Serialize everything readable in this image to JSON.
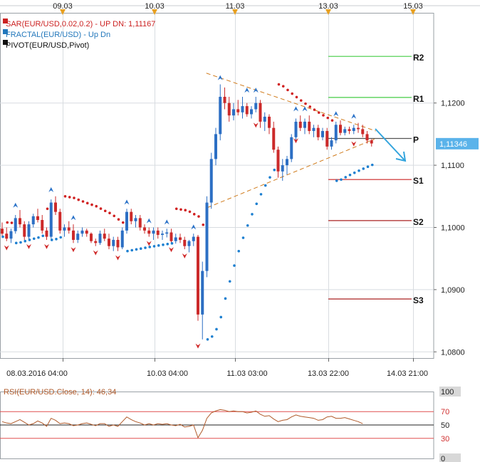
{
  "chart_data": [
    {
      "type": "candlestick",
      "symbol": "EUR/USD",
      "legend": [
        {
          "text": "SAR(EUR/USD,0.02,0.2) -  UP  DN: 1,11167",
          "color": "#cc2222"
        },
        {
          "text": "FRACTAL(EUR/USD) -  Up  Dn",
          "color": "#2277bb"
        },
        {
          "text": "PIVOT(EUR/USD,Pivot)",
          "color": "#111111"
        }
      ],
      "ylim": [
        1.079,
        1.1345
      ],
      "yticks": [
        {
          "value": 1.08,
          "label": "1,0800"
        },
        {
          "value": 1.09,
          "label": "1,0900"
        },
        {
          "value": 1.1,
          "label": "1,1000"
        },
        {
          "value": 1.11,
          "label": "1,1100"
        },
        {
          "value": 1.12,
          "label": "1,1200"
        }
      ],
      "top_dates": [
        "09.03",
        "10.03",
        "11.03",
        "13.03",
        "15.03"
      ],
      "bottom_dates": [
        "08.03.2016 04:00",
        "10.03 04:00",
        "11.03 03:00",
        "13.03 22:00",
        "14.03 21:00"
      ],
      "last_price": {
        "value": 1.11346,
        "label": "1,11346"
      },
      "pivot_levels": [
        {
          "name": "R2",
          "value": 1.1275,
          "color": "#44cc44"
        },
        {
          "name": "R1",
          "value": 1.1209,
          "color": "#44cc44"
        },
        {
          "name": "P",
          "value": 1.1143,
          "color": "#555555"
        },
        {
          "name": "S1",
          "value": 1.1077,
          "color": "#cc2222"
        },
        {
          "name": "S2",
          "value": 1.1011,
          "color": "#aa2222"
        },
        {
          "name": "S3",
          "value": 1.0885,
          "color": "#aa2222"
        }
      ],
      "candles": [
        [
          1.0998,
          1.1008,
          1.0985,
          1.099
        ],
        [
          1.099,
          1.1,
          1.0978,
          1.0982
        ],
        [
          1.0982,
          1.0998,
          1.0975,
          1.0994
        ],
        [
          1.0994,
          1.102,
          1.099,
          1.1015
        ],
        [
          1.1015,
          1.1028,
          1.1,
          1.1005
        ],
        [
          1.1005,
          1.101,
          1.098,
          1.0985
        ],
        [
          1.0985,
          1.101,
          1.098,
          1.1005
        ],
        [
          1.1005,
          1.1022,
          1.1,
          1.1018
        ],
        [
          1.1018,
          1.103,
          1.1008,
          1.1012
        ],
        [
          1.1012,
          1.102,
          1.099,
          1.0995
        ],
        [
          1.0995,
          1.1,
          1.098,
          1.0985
        ],
        [
          1.0985,
          1.1045,
          1.0982,
          1.104
        ],
        [
          1.104,
          1.105,
          1.102,
          1.1025
        ],
        [
          1.1025,
          1.103,
          1.099,
          1.0995
        ],
        [
          1.0995,
          1.1005,
          1.0985,
          1.1
        ],
        [
          1.1,
          1.101,
          1.099,
          1.0995
        ],
        [
          1.0995,
          1.1005,
          1.0975,
          1.098
        ],
        [
          1.098,
          1.0995,
          1.0975,
          1.099
        ],
        [
          1.099,
          1.1,
          1.0985,
          1.0995
        ],
        [
          1.0995,
          1.0998,
          1.0985,
          1.099
        ],
        [
          1.099,
          1.0992,
          1.0975,
          1.0978
        ],
        [
          1.0978,
          1.0982,
          1.097,
          1.0975
        ],
        [
          1.0975,
          1.0995,
          1.0972,
          1.099
        ],
        [
          1.099,
          1.0998,
          1.0978,
          1.0982
        ],
        [
          1.0982,
          1.099,
          1.0965,
          1.097
        ],
        [
          1.097,
          1.0985,
          1.0962,
          1.098
        ],
        [
          1.098,
          1.0985,
          1.0962,
          1.0968
        ],
        [
          1.0968,
          1.1,
          1.0965,
          1.0995
        ],
        [
          1.0995,
          1.103,
          1.099,
          1.1025
        ],
        [
          1.1025,
          1.103,
          1.1005,
          1.101
        ],
        [
          1.101,
          1.102,
          1.1,
          1.1015
        ],
        [
          1.1015,
          1.102,
          1.0995,
          1.1
        ],
        [
          1.1,
          1.1005,
          1.099,
          1.0995
        ],
        [
          1.0995,
          1.1,
          1.0985,
          1.099
        ],
        [
          1.099,
          1.1,
          1.098,
          1.0995
        ],
        [
          1.0995,
          1.1,
          1.0982,
          1.0988
        ],
        [
          1.0988,
          1.0995,
          1.098,
          1.099
        ],
        [
          1.099,
          1.0998,
          1.0984,
          1.0992
        ],
        [
          1.0992,
          1.0998,
          1.0975,
          1.0978
        ],
        [
          1.0978,
          1.099,
          1.0974,
          1.0984
        ],
        [
          1.0984,
          1.099,
          1.0975,
          1.098
        ],
        [
          1.098,
          1.0985,
          1.0965,
          1.097
        ],
        [
          1.097,
          1.098,
          1.096,
          1.0978
        ],
        [
          1.0978,
          1.099,
          1.097,
          1.0985
        ],
        [
          1.0985,
          1.0988,
          1.085,
          1.086
        ],
        [
          1.086,
          1.0945,
          1.082,
          1.093
        ],
        [
          1.093,
          1.105,
          1.092,
          1.104
        ],
        [
          1.104,
          1.112,
          1.103,
          1.111
        ],
        [
          1.111,
          1.116,
          1.11,
          1.115
        ],
        [
          1.115,
          1.123,
          1.114,
          1.121
        ],
        [
          1.121,
          1.1225,
          1.119,
          1.12
        ],
        [
          1.12,
          1.121,
          1.117,
          1.118
        ],
        [
          1.118,
          1.12,
          1.1172,
          1.119
        ],
        [
          1.119,
          1.1205,
          1.118,
          1.1185
        ],
        [
          1.1185,
          1.121,
          1.1175,
          1.1195
        ],
        [
          1.1195,
          1.12,
          1.1178,
          1.1182
        ],
        [
          1.1182,
          1.1195,
          1.1175,
          1.119
        ],
        [
          1.119,
          1.121,
          1.1185,
          1.12
        ],
        [
          1.12,
          1.1205,
          1.116,
          1.117
        ],
        [
          1.117,
          1.1185,
          1.1155,
          1.1178
        ],
        [
          1.1178,
          1.1182,
          1.115,
          1.116
        ],
        [
          1.116,
          1.117,
          1.112,
          1.1125
        ],
        [
          1.1125,
          1.113,
          1.108,
          1.109
        ],
        [
          1.109,
          1.111,
          1.1075,
          1.11
        ],
        [
          1.11,
          1.1115,
          1.1085,
          1.111
        ],
        [
          1.111,
          1.115,
          1.1105,
          1.1145
        ],
        [
          1.1145,
          1.1175,
          1.114,
          1.117
        ],
        [
          1.117,
          1.118,
          1.1155,
          1.116
        ],
        [
          1.116,
          1.1175,
          1.115,
          1.117
        ],
        [
          1.117,
          1.118,
          1.115,
          1.1155
        ],
        [
          1.1155,
          1.1165,
          1.1145,
          1.116
        ],
        [
          1.116,
          1.1165,
          1.114,
          1.1145
        ],
        [
          1.1145,
          1.116,
          1.114,
          1.1155
        ],
        [
          1.1155,
          1.116,
          1.1125,
          1.113
        ],
        [
          1.113,
          1.1145,
          1.1125,
          1.114
        ],
        [
          1.114,
          1.117,
          1.1135,
          1.1165
        ],
        [
          1.1165,
          1.1172,
          1.1148,
          1.1152
        ],
        [
          1.1152,
          1.1162,
          1.1148,
          1.1158
        ],
        [
          1.1158,
          1.1162,
          1.115,
          1.1155
        ],
        [
          1.1155,
          1.1165,
          1.115,
          1.116
        ],
        [
          1.116,
          1.1168,
          1.1152,
          1.1158
        ],
        [
          1.1158,
          1.1165,
          1.1145,
          1.115
        ],
        [
          1.115,
          1.1155,
          1.1135,
          1.114
        ],
        [
          1.114,
          1.1142,
          1.113,
          1.1135
        ]
      ],
      "fractal_up": [
        [
          3,
          1.1026
        ],
        [
          11,
          1.1051
        ],
        [
          16,
          1.1006
        ],
        [
          28,
          1.1031
        ],
        [
          33,
          1.1001
        ],
        [
          37,
          1.0999
        ],
        [
          43,
          1.0991
        ],
        [
          49,
          1.1231
        ],
        [
          55,
          1.1211
        ],
        [
          57,
          1.1211
        ],
        [
          66,
          1.1181
        ],
        [
          68,
          1.1181
        ],
        [
          75,
          1.1173
        ],
        [
          79,
          1.1169
        ]
      ],
      "fractal_dn": [
        [
          1,
          1.0977
        ],
        [
          6,
          1.0979
        ],
        [
          10,
          1.0979
        ],
        [
          16,
          1.0974
        ],
        [
          21,
          1.0969
        ],
        [
          26,
          1.0961
        ],
        [
          33,
          1.0984
        ],
        [
          38,
          1.0974
        ],
        [
          41,
          1.0964
        ],
        [
          44,
          1.0819
        ],
        [
          57,
          1.1174
        ],
        [
          66,
          1.1149
        ],
        [
          79,
          1.1144
        ]
      ]
    },
    {
      "type": "line",
      "title": "RSI(EUR/USD.Close, 14): 46,34",
      "ylim": [
        0,
        100
      ],
      "yticks": [
        {
          "value": 100,
          "label": "100"
        },
        {
          "value": 70,
          "label": "70"
        },
        {
          "value": 50,
          "label": "50"
        },
        {
          "value": 30,
          "label": "30"
        },
        {
          "value": 0,
          "label": "0"
        }
      ],
      "levels": [
        70,
        50,
        30
      ],
      "values": [
        55,
        53,
        52,
        55,
        58,
        54,
        50,
        52,
        56,
        53,
        48,
        60,
        57,
        52,
        53,
        52,
        49,
        50,
        52,
        53,
        51,
        49,
        52,
        52,
        48,
        50,
        48,
        55,
        62,
        58,
        55,
        53,
        50,
        52,
        50,
        52,
        51,
        52,
        50,
        49,
        51,
        47,
        48,
        50,
        31,
        42,
        60,
        68,
        71,
        73,
        72,
        70,
        71,
        70,
        70,
        68,
        69,
        71,
        66,
        63,
        64,
        59,
        55,
        57,
        58,
        62,
        65,
        63,
        62,
        61,
        60,
        57,
        58,
        62,
        63,
        60,
        60,
        61,
        59,
        57,
        55,
        52
      ]
    }
  ]
}
